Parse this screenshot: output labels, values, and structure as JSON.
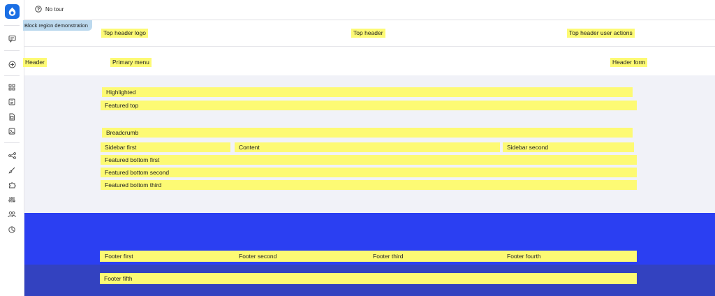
{
  "toolbar": {
    "tour_label": "No tour"
  },
  "demo_badge": "Block region demonstration",
  "regions": {
    "top_header_logo": "Top header logo",
    "top_header": "Top header",
    "top_header_user_actions": "Top header user actions",
    "header": "Header",
    "primary_menu": "Primary menu",
    "header_form": "Header form",
    "highlighted": "Highlighted",
    "featured_top": "Featured top",
    "breadcrumb": "Breadcrumb",
    "sidebar_first": "Sidebar first",
    "content": "Content",
    "sidebar_second": "Sidebar second",
    "featured_bottom_first": "Featured bottom first",
    "featured_bottom_second": "Featured bottom second",
    "featured_bottom_third": "Featured bottom third",
    "footer_first": "Footer first",
    "footer_second": "Footer second",
    "footer_third": "Footer third",
    "footer_fourth": "Footer fourth",
    "footer_fifth": "Footer fifth"
  },
  "colors": {
    "region_highlight": "#fdfa74",
    "brand_blue": "#1b6fe4",
    "main_background": "#f1f2f8",
    "footer_background": "#2b3ff2",
    "footer_bottom_background": "#3342c0",
    "badge_background": "#bcd9ee"
  },
  "icons": {
    "sidebar": [
      "drupal-logo-icon",
      "announcements-icon",
      "add-icon",
      "dashboard-icon",
      "content-icon",
      "files-icon",
      "media-icon",
      "structure-icon",
      "appearance-icon",
      "extend-icon",
      "configuration-icon",
      "people-icon",
      "reports-icon"
    ],
    "toolbar": [
      "help-icon"
    ]
  }
}
